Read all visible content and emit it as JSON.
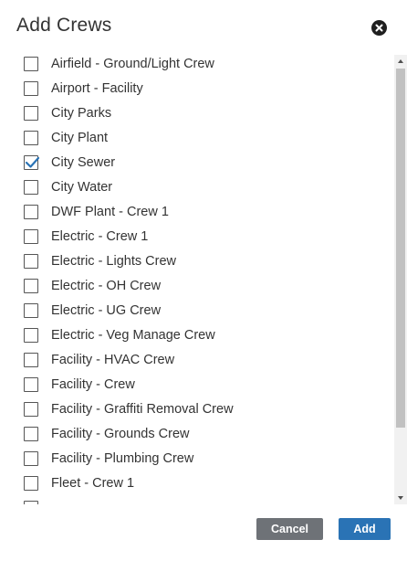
{
  "dialog": {
    "title": "Add Crews",
    "close_icon": "close-circle-icon",
    "cancel_label": "Cancel",
    "add_label": "Add",
    "colors": {
      "add_button": "#2a73b5",
      "cancel_button": "#6e7277",
      "checkmark": "#2a73b5"
    }
  },
  "crews": [
    {
      "label": "Airfield - Ground/Light Crew",
      "checked": false
    },
    {
      "label": "Airport - Facility",
      "checked": false
    },
    {
      "label": "City Parks",
      "checked": false
    },
    {
      "label": "City Plant",
      "checked": false
    },
    {
      "label": "City Sewer",
      "checked": true
    },
    {
      "label": "City Water",
      "checked": false
    },
    {
      "label": "DWF Plant - Crew 1",
      "checked": false
    },
    {
      "label": "Electric - Crew 1",
      "checked": false
    },
    {
      "label": "Electric - Lights Crew",
      "checked": false
    },
    {
      "label": "Electric - OH Crew",
      "checked": false
    },
    {
      "label": "Electric - UG Crew",
      "checked": false
    },
    {
      "label": "Electric - Veg Manage Crew",
      "checked": false
    },
    {
      "label": "Facility - HVAC Crew",
      "checked": false
    },
    {
      "label": "Facility - Crew",
      "checked": false
    },
    {
      "label": "Facility - Graffiti Removal Crew",
      "checked": false
    },
    {
      "label": "Facility - Grounds Crew",
      "checked": false
    },
    {
      "label": "Facility - Plumbing Crew",
      "checked": false
    },
    {
      "label": "Fleet - Crew 1",
      "checked": false
    },
    {
      "label": "",
      "checked": false
    }
  ]
}
